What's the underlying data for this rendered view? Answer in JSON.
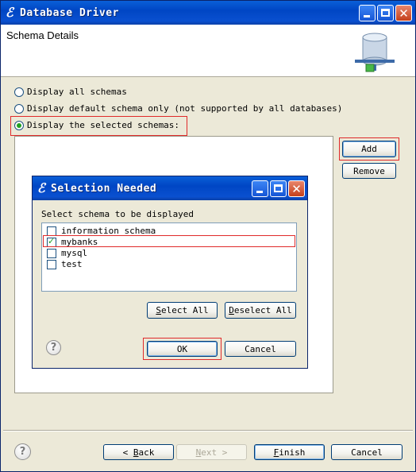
{
  "window": {
    "title": "Database Driver"
  },
  "header": {
    "title": "Schema Details"
  },
  "options": {
    "all": "Display all schemas",
    "default": "Display default schema only (not supported by all databases)",
    "selected": "Display the selected schemas:"
  },
  "side_buttons": {
    "add": "Add",
    "remove": "Remove"
  },
  "dialog": {
    "title": "Selection Needed",
    "prompt": "Select schema to be displayed",
    "schemas": [
      {
        "name": "information_schema",
        "checked": false
      },
      {
        "name": "mybanks",
        "checked": true
      },
      {
        "name": "mysql",
        "checked": false
      },
      {
        "name": "test",
        "checked": false
      }
    ],
    "select_all": {
      "mnemonic": "S",
      "rest": "elect All"
    },
    "deselect_all": {
      "mnemonic": "D",
      "rest": "eselect All"
    },
    "ok": "OK",
    "cancel": "Cancel"
  },
  "footer": {
    "back": {
      "prefix": "< ",
      "mnemonic": "B",
      "rest": "ack"
    },
    "next": {
      "mnemonic": "N",
      "rest": "ext >"
    },
    "finish": {
      "mnemonic": "F",
      "rest": "inish"
    },
    "cancel": "Cancel"
  },
  "colors": {
    "accent": "#0a50d0",
    "highlight": "#e02a2a",
    "dialog_bg": "#ece9d8"
  }
}
